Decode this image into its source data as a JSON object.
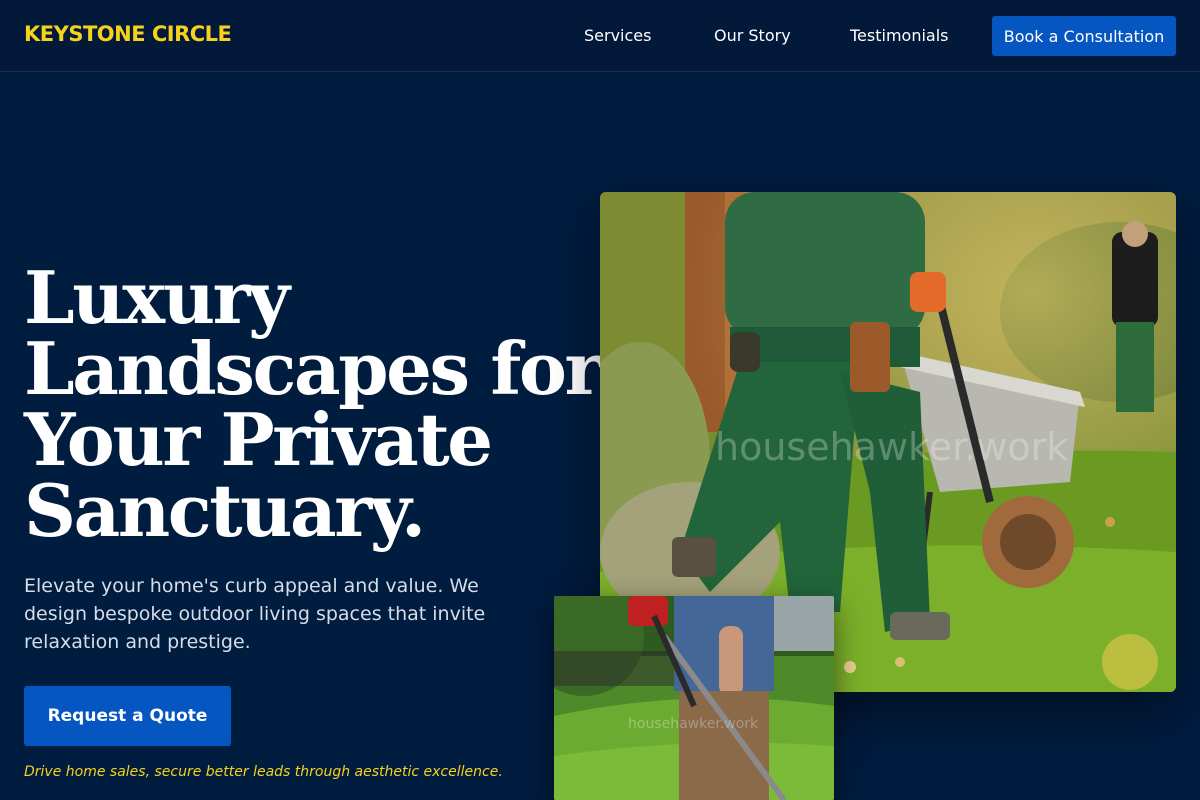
{
  "header": {
    "logo": "KEYSTONE CIRCLE",
    "nav": {
      "services": "Services",
      "story": "Our Story",
      "testimonials": "Testimonials"
    },
    "cta": "Book a Consultation"
  },
  "hero": {
    "title_lines": [
      "Luxury",
      "Landscapes for",
      "Your Private",
      "Sanctuary."
    ],
    "description": "Elevate your home's curb appeal and value. We design bespoke outdoor living spaces that invite relaxation and prestige.",
    "cta": "Request a Quote",
    "tagline": "Drive home sales, secure better leads through aesthetic excellence."
  },
  "images": {
    "main_watermark": "househawker.work",
    "inset_watermark": "househawker.work"
  },
  "colors": {
    "background": "#001c3f",
    "accent_yellow": "#f6d21c",
    "button_blue": "#0656c2"
  }
}
